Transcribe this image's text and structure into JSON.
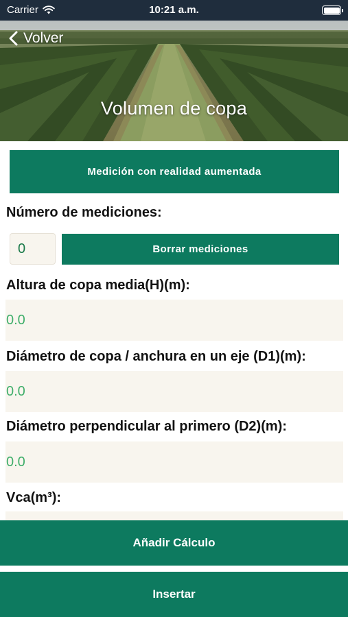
{
  "status_bar": {
    "carrier": "Carrier",
    "time": "10:21 a.m."
  },
  "header": {
    "back_label": "Volver",
    "title": "Volumen de copa"
  },
  "actions": {
    "ar_button_label": "Medición con realidad aumentada",
    "clear_button_label": "Borrar mediciones",
    "add_button_label": "Añadir Cálculo",
    "insert_button_label": "Insertar"
  },
  "measurements": {
    "label": "Número de mediciones:",
    "count": "0"
  },
  "fields": [
    {
      "label": "Altura de copa media(H)(m):",
      "value": "0.0"
    },
    {
      "label": "Diámetro de copa / anchura en un eje (D1)(m):",
      "value": "0.0"
    },
    {
      "label": "Diámetro perpendicular al primero (D2)(m):",
      "value": "0.0"
    },
    {
      "label": "Vca(m³):",
      "value": ""
    }
  ],
  "colors": {
    "primary": "#0d7a5f",
    "field_background": "#f8f5ee",
    "value_text": "#3fae6a",
    "status_bar": "#1f2d3d"
  },
  "icons": {
    "back": "chevron-left-icon",
    "wifi": "wifi-icon",
    "battery": "battery-icon"
  }
}
